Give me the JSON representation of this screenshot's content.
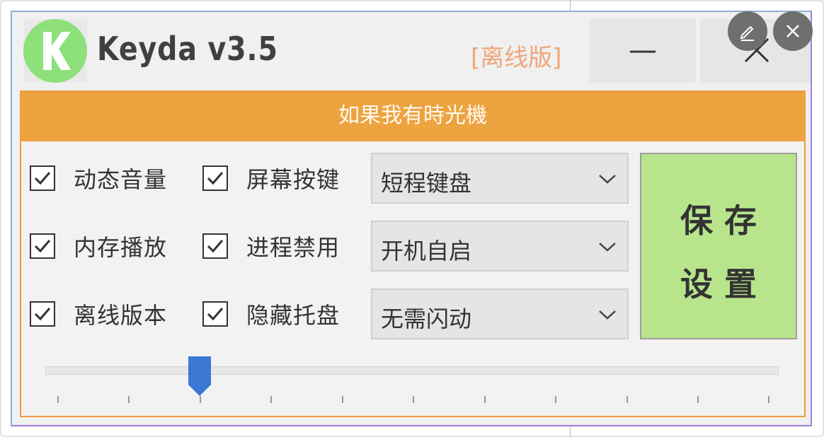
{
  "window": {
    "app_name": "Keyda v3.5",
    "edition_label": "[离线版]",
    "minimize_label": "—"
  },
  "banner": {
    "text": "如果我有時光機"
  },
  "options": [
    {
      "label": "动态音量",
      "checked": true
    },
    {
      "label": "屏幕按键",
      "checked": true
    },
    {
      "label": "内存播放",
      "checked": true
    },
    {
      "label": "进程禁用",
      "checked": true
    },
    {
      "label": "离线版本",
      "checked": true
    },
    {
      "label": "隐藏托盘",
      "checked": true
    }
  ],
  "dropdowns": [
    {
      "value": "短程键盘"
    },
    {
      "value": "开机自启"
    },
    {
      "value": "无需闪动"
    }
  ],
  "save_button": {
    "line1": "保 存",
    "line2": "设 置"
  },
  "slider": {
    "tick_count": 11,
    "value_fraction": 0.2
  },
  "colors": {
    "banner": "#eda33f",
    "save_button": "#b8e58c",
    "logo": "#8ee07a",
    "slider_thumb": "#3a78d4",
    "edition": "#f0a67a"
  },
  "icons": {
    "logo": "k-logo-icon",
    "close": "close-icon",
    "edit": "pencil-icon",
    "dropdown": "chevron-down-icon",
    "check": "checkmark-icon"
  }
}
